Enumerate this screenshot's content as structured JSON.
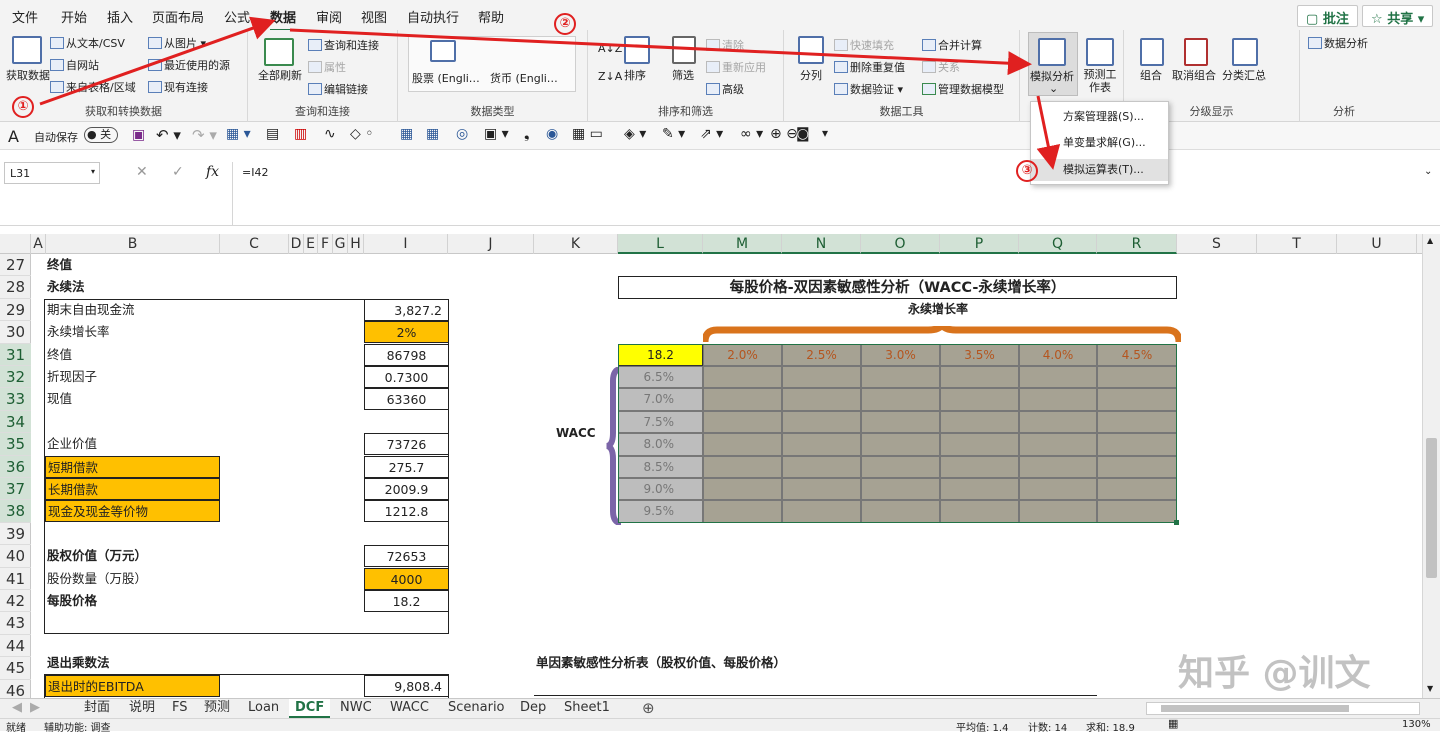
{
  "menu": {
    "tabs": [
      "文件",
      "开始",
      "插入",
      "页面布局",
      "公式",
      "数据",
      "审阅",
      "视图",
      "自动执行",
      "帮助"
    ],
    "active_tab": "数据",
    "comment_btn": "批注",
    "share_btn": "共享"
  },
  "ribbon": {
    "get_data": {
      "big": "获取数据",
      "items": [
        "从文本/CSV",
        "自网站",
        "来自表格/区域",
        "从图片",
        "最近使用的源",
        "现有连接"
      ],
      "label": "获取和转换数据"
    },
    "queries": {
      "big": "全部刷新",
      "items": [
        "查询和连接",
        "属性",
        "编辑链接"
      ],
      "label": "查询和连接"
    },
    "data_types": {
      "items": [
        "股票 (Engli…",
        "货币 (Engli…"
      ],
      "label": "数据类型"
    },
    "sort_filter": {
      "items": [
        "排序",
        "筛选",
        "清除",
        "重新应用",
        "高级"
      ],
      "label": "排序和筛选"
    },
    "data_tools": {
      "items": [
        "分列",
        "快速填充",
        "删除重复值",
        "数据验证",
        "合并计算",
        "关系",
        "管理数据模型"
      ],
      "label": "数据工具"
    },
    "forecast": {
      "items": [
        "模拟分析",
        "预测工作表"
      ],
      "label": "预测"
    },
    "outline": {
      "items": [
        "组合",
        "取消组合",
        "分类汇总"
      ],
      "label": "分级显示"
    },
    "analysis": {
      "items": [
        "数据分析"
      ],
      "label": "分析"
    }
  },
  "dropdown": {
    "items": [
      "方案管理器(S)...",
      "单变量求解(G)...",
      "模拟运算表(T)..."
    ],
    "highlighted": "模拟运算表(T)..."
  },
  "qat": {
    "autosave_label": "自动保存",
    "autosave_state": "关"
  },
  "formula_bar": {
    "name_box": "L31",
    "formula": "=I42"
  },
  "columns": [
    "A",
    "B",
    "C",
    "D",
    "E",
    "F",
    "G",
    "H",
    "I",
    "J",
    "K",
    "L",
    "M",
    "N",
    "O",
    "P",
    "Q",
    "R",
    "S",
    "T",
    "U"
  ],
  "rows": [
    "27",
    "28",
    "29",
    "30",
    "31",
    "32",
    "33",
    "34",
    "35",
    "36",
    "37",
    "38",
    "39",
    "40",
    "41",
    "42",
    "43",
    "44",
    "45",
    "46"
  ],
  "sheet": {
    "r27": "终值",
    "r28": "永续法",
    "lines": [
      {
        "label": "期末自由现金流",
        "value": "3,827.2"
      },
      {
        "label": "永续增长率",
        "value": "2%"
      },
      {
        "label": "终值",
        "value": "86798"
      },
      {
        "label": "折现因子",
        "value": "0.7300"
      },
      {
        "label": "现值",
        "value": "63360"
      },
      {
        "label": "企业价值",
        "value": "73726"
      },
      {
        "label": "短期借款",
        "value": "275.7"
      },
      {
        "label": "长期借款",
        "value": "2009.9"
      },
      {
        "label": "现金及现金等价物",
        "value": "1212.8"
      },
      {
        "label": "股权价值（万元）",
        "value": "72653"
      },
      {
        "label": "股份数量（万股）",
        "value": "4000"
      },
      {
        "label": "每股价格",
        "value": "18.2"
      }
    ],
    "r45": "退出乘数法",
    "r46": {
      "label": "退出时的EBITDA",
      "value": "9,808.4"
    },
    "single_factor_title": "单因素敏感性分析表（股权价值、每股价格）"
  },
  "sensitivity": {
    "title": "每股价格-双因素敏感性分析（WACC-永续增长率）",
    "col_axis_label": "永续增长率",
    "row_axis_label": "WACC",
    "corner": "18.2",
    "growth_rates": [
      "2.0%",
      "2.5%",
      "3.0%",
      "3.5%",
      "4.0%",
      "4.5%"
    ],
    "waccs": [
      "6.5%",
      "7.0%",
      "7.5%",
      "8.0%",
      "8.5%",
      "9.0%",
      "9.5%"
    ]
  },
  "annotations": [
    "①",
    "②",
    "③"
  ],
  "sheet_tabs": [
    "封面",
    "说明",
    "FS",
    "预测",
    "Loan",
    "DCF",
    "NWC",
    "WACC",
    "Scenario",
    "Dep",
    "Sheet1"
  ],
  "active_sheet": "DCF",
  "watermark": "知乎 @训文",
  "status": {
    "left": "就绪",
    "accessibility": "辅助功能: 调查",
    "avg": "平均值: 1.4",
    "count": "计数: 14",
    "sum": "求和: 18.9",
    "zoom": "130%"
  }
}
